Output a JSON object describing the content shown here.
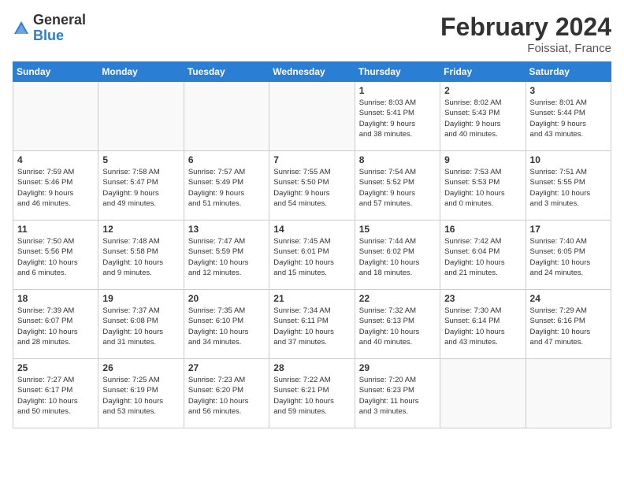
{
  "header": {
    "logo_general": "General",
    "logo_blue": "Blue",
    "title": "February 2024",
    "subtitle": "Foissiat, France"
  },
  "columns": [
    "Sunday",
    "Monday",
    "Tuesday",
    "Wednesday",
    "Thursday",
    "Friday",
    "Saturday"
  ],
  "weeks": [
    [
      {
        "day": "",
        "info": ""
      },
      {
        "day": "",
        "info": ""
      },
      {
        "day": "",
        "info": ""
      },
      {
        "day": "",
        "info": ""
      },
      {
        "day": "1",
        "info": "Sunrise: 8:03 AM\nSunset: 5:41 PM\nDaylight: 9 hours\nand 38 minutes."
      },
      {
        "day": "2",
        "info": "Sunrise: 8:02 AM\nSunset: 5:43 PM\nDaylight: 9 hours\nand 40 minutes."
      },
      {
        "day": "3",
        "info": "Sunrise: 8:01 AM\nSunset: 5:44 PM\nDaylight: 9 hours\nand 43 minutes."
      }
    ],
    [
      {
        "day": "4",
        "info": "Sunrise: 7:59 AM\nSunset: 5:46 PM\nDaylight: 9 hours\nand 46 minutes."
      },
      {
        "day": "5",
        "info": "Sunrise: 7:58 AM\nSunset: 5:47 PM\nDaylight: 9 hours\nand 49 minutes."
      },
      {
        "day": "6",
        "info": "Sunrise: 7:57 AM\nSunset: 5:49 PM\nDaylight: 9 hours\nand 51 minutes."
      },
      {
        "day": "7",
        "info": "Sunrise: 7:55 AM\nSunset: 5:50 PM\nDaylight: 9 hours\nand 54 minutes."
      },
      {
        "day": "8",
        "info": "Sunrise: 7:54 AM\nSunset: 5:52 PM\nDaylight: 9 hours\nand 57 minutes."
      },
      {
        "day": "9",
        "info": "Sunrise: 7:53 AM\nSunset: 5:53 PM\nDaylight: 10 hours\nand 0 minutes."
      },
      {
        "day": "10",
        "info": "Sunrise: 7:51 AM\nSunset: 5:55 PM\nDaylight: 10 hours\nand 3 minutes."
      }
    ],
    [
      {
        "day": "11",
        "info": "Sunrise: 7:50 AM\nSunset: 5:56 PM\nDaylight: 10 hours\nand 6 minutes."
      },
      {
        "day": "12",
        "info": "Sunrise: 7:48 AM\nSunset: 5:58 PM\nDaylight: 10 hours\nand 9 minutes."
      },
      {
        "day": "13",
        "info": "Sunrise: 7:47 AM\nSunset: 5:59 PM\nDaylight: 10 hours\nand 12 minutes."
      },
      {
        "day": "14",
        "info": "Sunrise: 7:45 AM\nSunset: 6:01 PM\nDaylight: 10 hours\nand 15 minutes."
      },
      {
        "day": "15",
        "info": "Sunrise: 7:44 AM\nSunset: 6:02 PM\nDaylight: 10 hours\nand 18 minutes."
      },
      {
        "day": "16",
        "info": "Sunrise: 7:42 AM\nSunset: 6:04 PM\nDaylight: 10 hours\nand 21 minutes."
      },
      {
        "day": "17",
        "info": "Sunrise: 7:40 AM\nSunset: 6:05 PM\nDaylight: 10 hours\nand 24 minutes."
      }
    ],
    [
      {
        "day": "18",
        "info": "Sunrise: 7:39 AM\nSunset: 6:07 PM\nDaylight: 10 hours\nand 28 minutes."
      },
      {
        "day": "19",
        "info": "Sunrise: 7:37 AM\nSunset: 6:08 PM\nDaylight: 10 hours\nand 31 minutes."
      },
      {
        "day": "20",
        "info": "Sunrise: 7:35 AM\nSunset: 6:10 PM\nDaylight: 10 hours\nand 34 minutes."
      },
      {
        "day": "21",
        "info": "Sunrise: 7:34 AM\nSunset: 6:11 PM\nDaylight: 10 hours\nand 37 minutes."
      },
      {
        "day": "22",
        "info": "Sunrise: 7:32 AM\nSunset: 6:13 PM\nDaylight: 10 hours\nand 40 minutes."
      },
      {
        "day": "23",
        "info": "Sunrise: 7:30 AM\nSunset: 6:14 PM\nDaylight: 10 hours\nand 43 minutes."
      },
      {
        "day": "24",
        "info": "Sunrise: 7:29 AM\nSunset: 6:16 PM\nDaylight: 10 hours\nand 47 minutes."
      }
    ],
    [
      {
        "day": "25",
        "info": "Sunrise: 7:27 AM\nSunset: 6:17 PM\nDaylight: 10 hours\nand 50 minutes."
      },
      {
        "day": "26",
        "info": "Sunrise: 7:25 AM\nSunset: 6:19 PM\nDaylight: 10 hours\nand 53 minutes."
      },
      {
        "day": "27",
        "info": "Sunrise: 7:23 AM\nSunset: 6:20 PM\nDaylight: 10 hours\nand 56 minutes."
      },
      {
        "day": "28",
        "info": "Sunrise: 7:22 AM\nSunset: 6:21 PM\nDaylight: 10 hours\nand 59 minutes."
      },
      {
        "day": "29",
        "info": "Sunrise: 7:20 AM\nSunset: 6:23 PM\nDaylight: 11 hours\nand 3 minutes."
      },
      {
        "day": "",
        "info": ""
      },
      {
        "day": "",
        "info": ""
      }
    ]
  ]
}
